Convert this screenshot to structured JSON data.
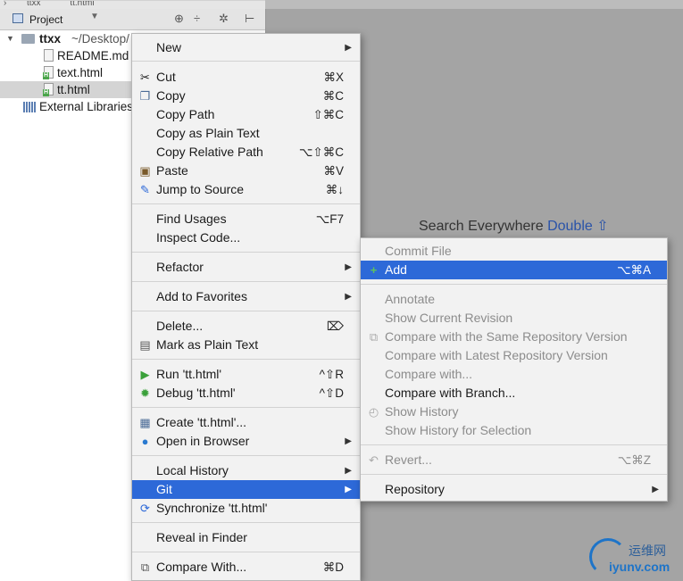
{
  "topbar": {
    "crumb1": "ttxx",
    "crumb2": "tt.html"
  },
  "panel": {
    "title": "Project",
    "tree": [
      {
        "label": "ttxx",
        "suffix": "~/Desktop/"
      },
      {
        "label": "README.md"
      },
      {
        "label": "text.html"
      },
      {
        "label": "tt.html"
      },
      {
        "label": "External Libraries"
      }
    ]
  },
  "editor": {
    "search_hint": "Search Everywhere",
    "search_hint_key": "Double ⇧"
  },
  "context_menu": {
    "items": [
      {
        "label": "New",
        "shortcut": "",
        "submenu": true
      },
      {
        "label": "Cut",
        "shortcut": "⌘X",
        "icon": "scissors-icon"
      },
      {
        "label": "Copy",
        "shortcut": "⌘C",
        "icon": "copy-icon"
      },
      {
        "label": "Copy Path",
        "shortcut": "⇧⌘C"
      },
      {
        "label": "Copy as Plain Text",
        "shortcut": ""
      },
      {
        "label": "Copy Relative Path",
        "shortcut": "⌥⇧⌘C"
      },
      {
        "label": "Paste",
        "shortcut": "⌘V",
        "icon": "paste-icon"
      },
      {
        "label": "Jump to Source",
        "shortcut": "⌘↓",
        "icon": "edit-icon"
      },
      {
        "label": "Find Usages",
        "shortcut": "⌥F7"
      },
      {
        "label": "Inspect Code...",
        "shortcut": ""
      },
      {
        "label": "Refactor",
        "shortcut": "",
        "submenu": true
      },
      {
        "label": "Add to Favorites",
        "shortcut": "",
        "submenu": true
      },
      {
        "label": "Delete...",
        "shortcut": "⌦"
      },
      {
        "label": "Mark as Plain Text",
        "shortcut": "",
        "icon": "text-file-icon"
      },
      {
        "label": "Run 'tt.html'",
        "shortcut": "^⇧R",
        "icon": "run-icon"
      },
      {
        "label": "Debug 'tt.html'",
        "shortcut": "^⇧D",
        "icon": "debug-icon"
      },
      {
        "label": "Create 'tt.html'...",
        "shortcut": "",
        "icon": "create-config-icon"
      },
      {
        "label": "Open in Browser",
        "shortcut": "",
        "submenu": true,
        "icon": "globe-icon"
      },
      {
        "label": "Local History",
        "shortcut": "",
        "submenu": true
      },
      {
        "label": "Git",
        "shortcut": "",
        "submenu": true,
        "highlighted": true
      },
      {
        "label": "Synchronize 'tt.html'",
        "shortcut": "",
        "icon": "sync-icon"
      },
      {
        "label": "Reveal in Finder",
        "shortcut": ""
      },
      {
        "label": "Compare With...",
        "shortcut": "⌘D",
        "icon": "compare-icon"
      }
    ]
  },
  "git_submenu": {
    "items": [
      {
        "label": "Commit File",
        "shortcut": "",
        "disabled": true
      },
      {
        "label": "Add",
        "shortcut": "⌥⌘A",
        "highlighted": true,
        "icon": "plus-icon"
      },
      {
        "label": "Annotate",
        "shortcut": "",
        "disabled": true
      },
      {
        "label": "Show Current Revision",
        "shortcut": "",
        "disabled": true
      },
      {
        "label": "Compare with the Same Repository Version",
        "shortcut": "",
        "disabled": true,
        "icon": "compare-icon"
      },
      {
        "label": "Compare with Latest Repository Version",
        "shortcut": "",
        "disabled": true
      },
      {
        "label": "Compare with...",
        "shortcut": "",
        "disabled": true
      },
      {
        "label": "Compare with Branch...",
        "shortcut": ""
      },
      {
        "label": "Show History",
        "shortcut": "",
        "disabled": true,
        "icon": "history-icon"
      },
      {
        "label": "Show History for Selection",
        "shortcut": "",
        "disabled": true
      },
      {
        "label": "Revert...",
        "shortcut": "⌥⌘Z",
        "disabled": true,
        "icon": "revert-icon"
      },
      {
        "label": "Repository",
        "shortcut": "",
        "submenu": true
      }
    ]
  },
  "watermark": {
    "cn": "运维网",
    "en": "iyunv.com"
  },
  "colors": {
    "highlight": "#2d69d8",
    "menu_bg": "#f2f2f2",
    "disabled_text": "#8c8c8c"
  }
}
